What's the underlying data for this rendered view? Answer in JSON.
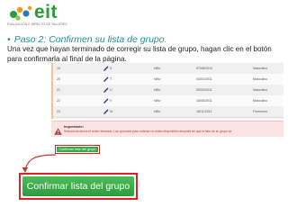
{
  "logo": {
    "text": "eit",
    "tagline": "EVALUACIÓN E IMPACTO DE TALLERES",
    "colors": {
      "green": "#2e9a3c",
      "orange": "#f39c12",
      "blue": "#2a7ab8"
    }
  },
  "heading": {
    "bullet": "•",
    "title": "Paso 2: Confirmen su lista de grupo."
  },
  "instructions": "Una vez que hayan terminado de corregir su lista de grupo, hagan clic en el botón para confirmarla al final de la página.",
  "table": {
    "rows": [
      {
        "num": "19",
        "edit_icon": "pencil-icon",
        "letter": "S",
        "type": "Niño",
        "date": "07/08/2010",
        "gender": "Masculino"
      },
      {
        "num": "20",
        "edit_icon": "pencil-icon",
        "letter": "T",
        "type": "Niño",
        "date": "04/01/2011",
        "gender": "Masculino"
      },
      {
        "num": "21",
        "edit_icon": "pencil-icon",
        "letter": "U",
        "type": "Niño",
        "date": "05/05/2011",
        "gender": "Masculino"
      },
      {
        "num": "22",
        "edit_icon": "pencil-icon",
        "letter": "V",
        "type": "Niño",
        "date": "16/08/2011",
        "gender": "Masculino"
      },
      {
        "num": "23",
        "edit_icon": "pencil-icon",
        "letter": "W",
        "type": "Niño",
        "date": "18/11/2011",
        "gender": "Femenino"
      }
    ]
  },
  "notice": {
    "icon": "warning-icon",
    "title": "Importante:",
    "text": "Seleccione ahora el orden deseado. Las opciones para ordenar no están disponibles después de que la lista de su grupo se"
  },
  "small_button": {
    "label": "Confirmar lista del grupo"
  },
  "arrow": {
    "icon": "curved-arrow-icon",
    "color": "#c0392b"
  },
  "big_button": {
    "label": "Confirmar lista del grupo",
    "color": "#3aa84a"
  }
}
